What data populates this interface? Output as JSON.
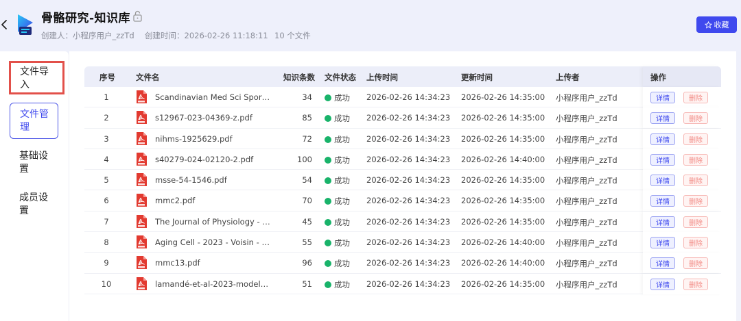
{
  "header": {
    "title": "骨骼研究-知识库",
    "creator": "创建人：小程序用户_zzTd",
    "created_at": "创建时间：2026-02-26 11:18:11",
    "file_count": "10 个文件",
    "collect_label": "收藏",
    "brand_color": "#3f49ee"
  },
  "sidebar": {
    "items": [
      {
        "label": "文件导入",
        "state": "highlighted"
      },
      {
        "label": "文件管理",
        "state": "active"
      },
      {
        "label": "基础设置",
        "state": "normal"
      },
      {
        "label": "成员设置",
        "state": "normal"
      }
    ]
  },
  "table": {
    "columns": [
      "序号",
      "文件名",
      "知识条数",
      "文件状态",
      "上传时间",
      "更新时间",
      "上传者",
      "操作"
    ],
    "detail_label": "详情",
    "delete_label": "删除",
    "rows": [
      {
        "no": "1",
        "name": "Scandinavian Med Sci Sports - ...",
        "count": "34",
        "status": "成功",
        "uploaded": "2026-02-26 14:34:23",
        "updated": "2026-02-26 14:35:00",
        "user": "小程序用户_zzTd"
      },
      {
        "no": "2",
        "name": "s12967-023-04369-z.pdf",
        "count": "85",
        "status": "成功",
        "uploaded": "2026-02-26 14:34:23",
        "updated": "2026-02-26 14:35:00",
        "user": "小程序用户_zzTd"
      },
      {
        "no": "3",
        "name": "nihms-1925629.pdf",
        "count": "72",
        "status": "成功",
        "uploaded": "2026-02-26 14:34:23",
        "updated": "2026-02-26 14:35:00",
        "user": "小程序用户_zzTd"
      },
      {
        "no": "4",
        "name": "s40279-024-02120-2.pdf",
        "count": "100",
        "status": "成功",
        "uploaded": "2026-02-26 14:34:23",
        "updated": "2026-02-26 14:40:00",
        "user": "小程序用户_zzTd"
      },
      {
        "no": "5",
        "name": "msse-54-1546.pdf",
        "count": "54",
        "status": "成功",
        "uploaded": "2026-02-26 14:34:23",
        "updated": "2026-02-26 14:35:00",
        "user": "小程序用户_zzTd"
      },
      {
        "no": "6",
        "name": "mmc2.pdf",
        "count": "70",
        "status": "成功",
        "uploaded": "2026-02-26 14:34:23",
        "updated": "2026-02-26 14:35:00",
        "user": "小程序用户_zzTd"
      },
      {
        "no": "7",
        "name": "The Journal of Physiology - 202...",
        "count": "45",
        "status": "成功",
        "uploaded": "2026-02-26 14:34:23",
        "updated": "2026-02-26 14:35:00",
        "user": "小程序用户_zzTd"
      },
      {
        "no": "8",
        "name": "Aging Cell - 2023 - Voisin - Exe...",
        "count": "55",
        "status": "成功",
        "uploaded": "2026-02-26 14:34:23",
        "updated": "2026-02-26 14:40:00",
        "user": "小程序用户_zzTd"
      },
      {
        "no": "9",
        "name": "mmc13.pdf",
        "count": "96",
        "status": "成功",
        "uploaded": "2026-02-26 14:34:23",
        "updated": "2026-02-26 14:40:00",
        "user": "小程序用户_zzTd"
      },
      {
        "no": "10",
        "name": "lamandé-et-al-2023-modeling-...",
        "count": "51",
        "status": "成功",
        "uploaded": "2026-02-26 14:34:23",
        "updated": "2026-02-26 14:35:00",
        "user": "小程序用户_zzTd"
      }
    ]
  }
}
